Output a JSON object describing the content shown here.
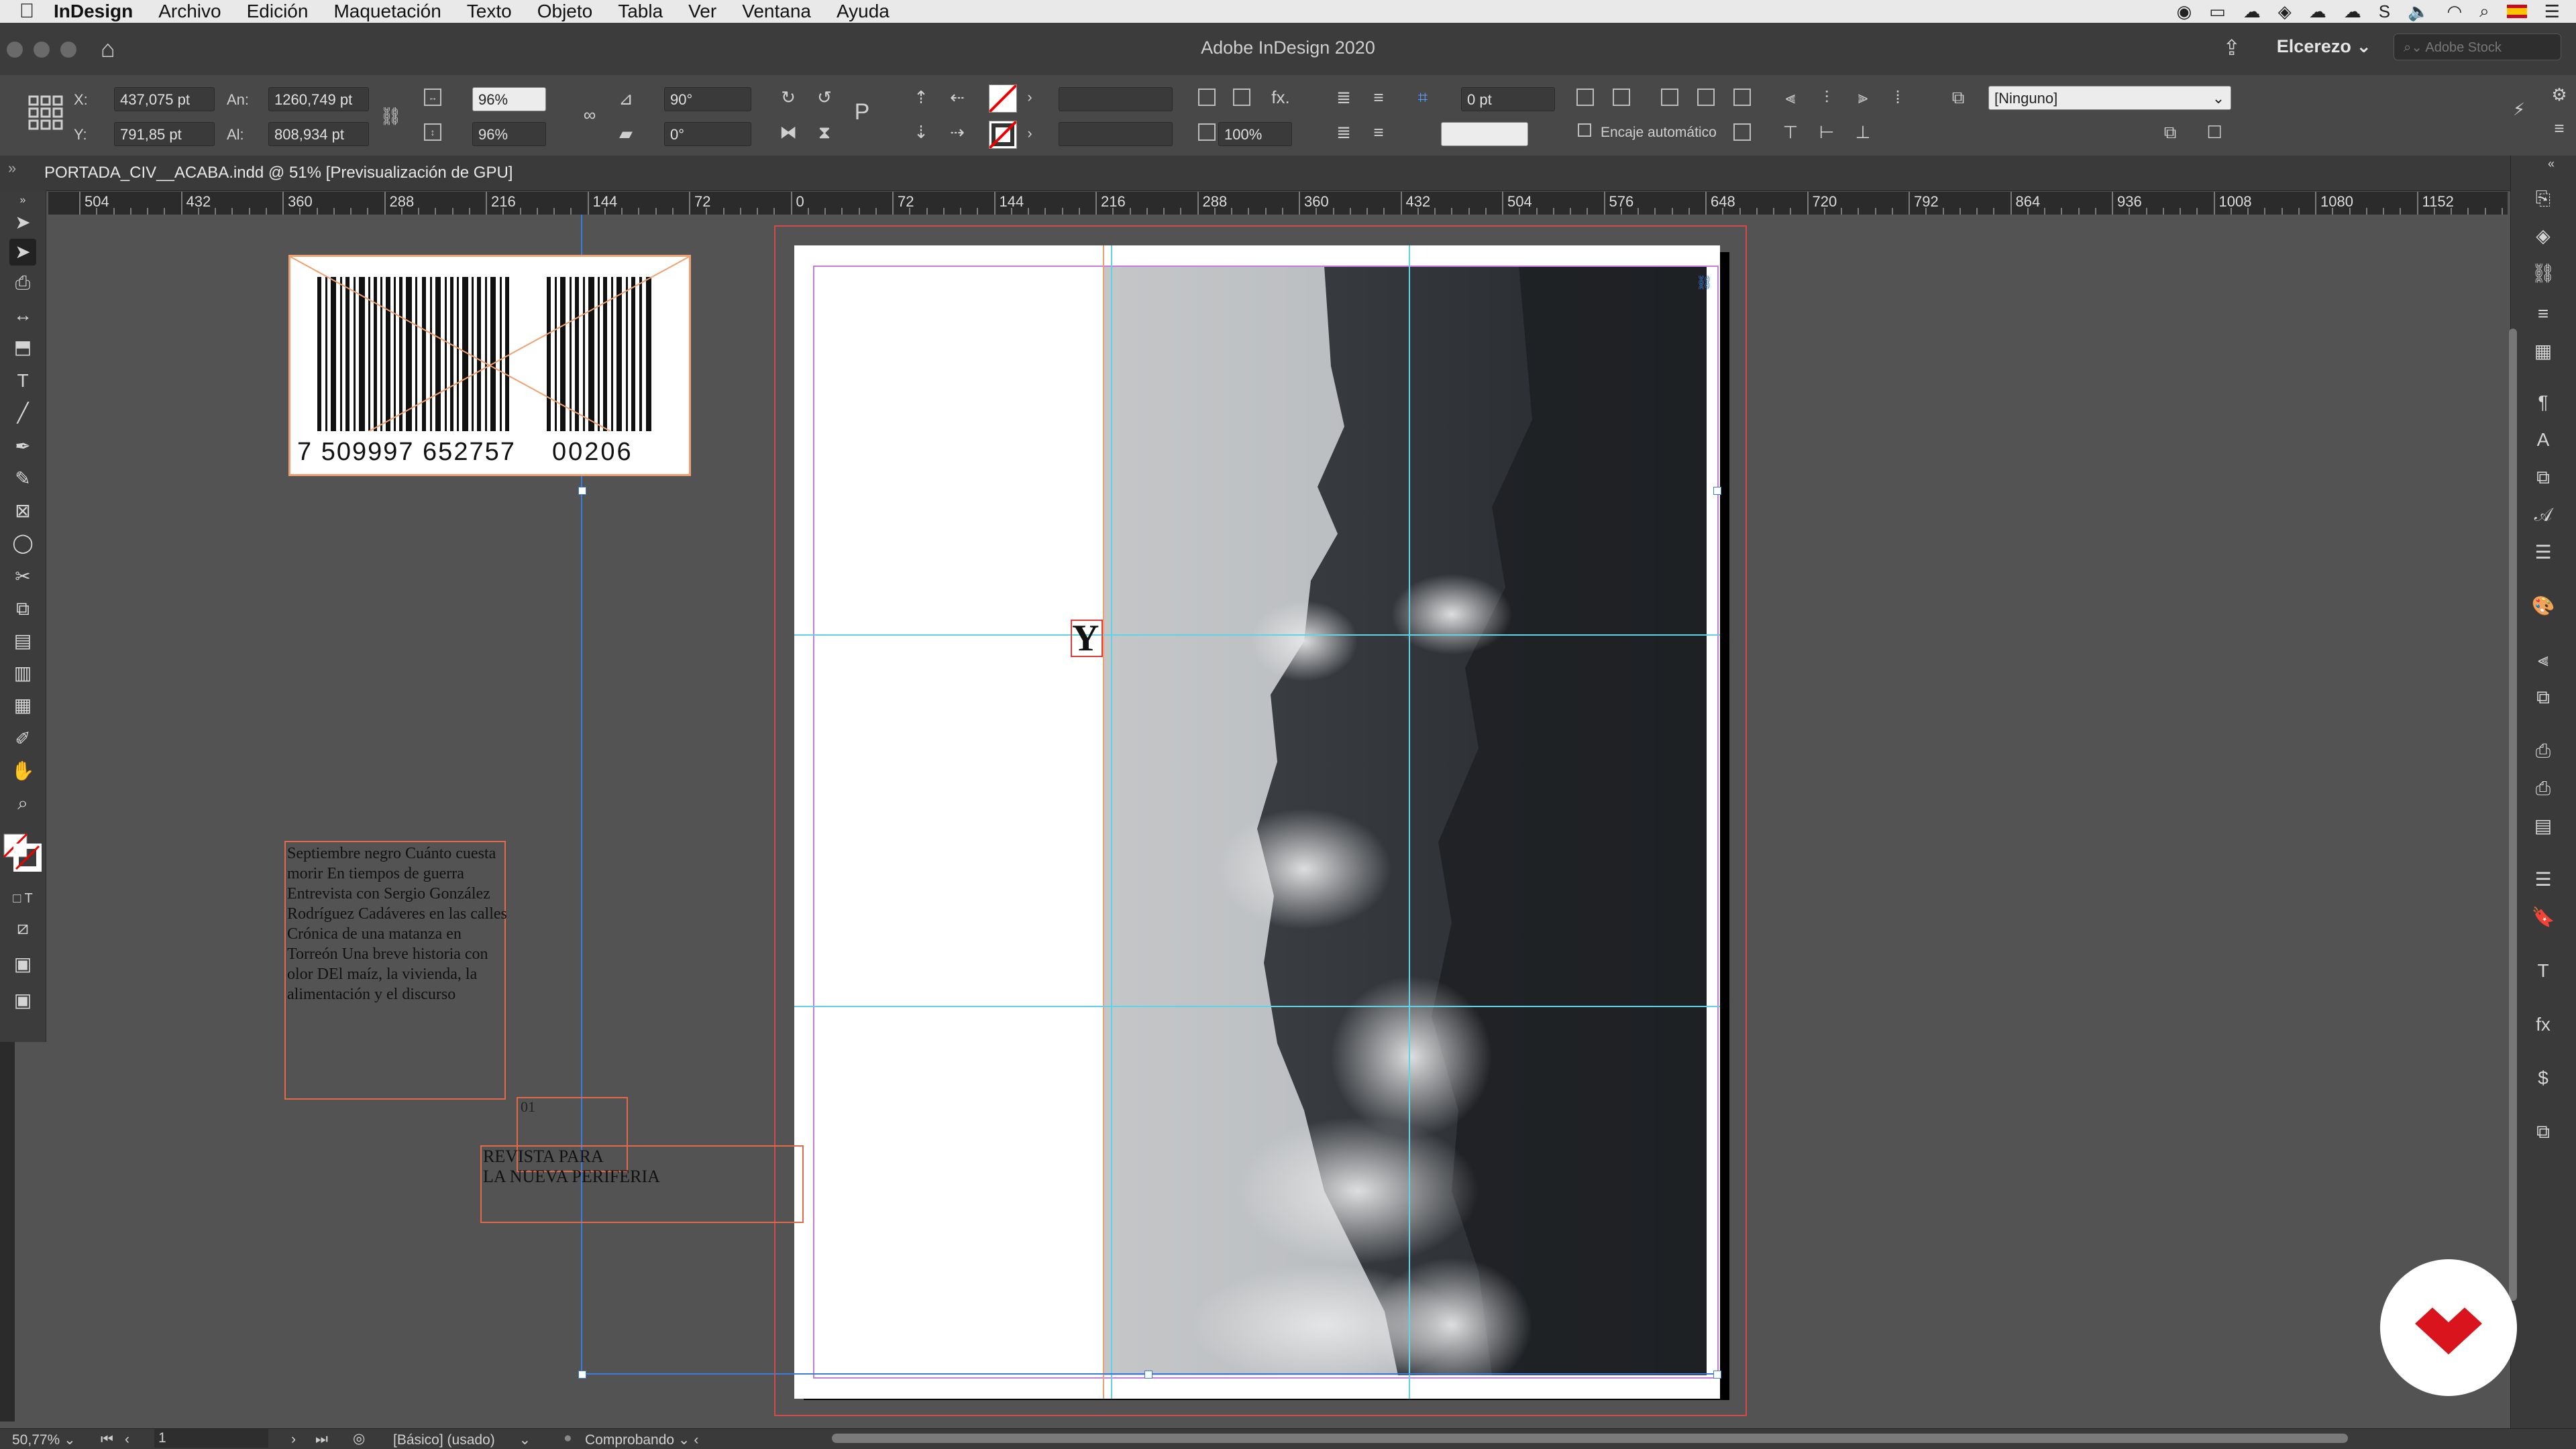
{
  "menubar": {
    "apple": "",
    "items": [
      "InDesign",
      "Archivo",
      "Edición",
      "Maquetación",
      "Texto",
      "Objeto",
      "Tabla",
      "Ver",
      "Ventana",
      "Ayuda"
    ]
  },
  "titlebar": {
    "title": "Adobe InDesign 2020",
    "workspace": "Elcerezo",
    "stock_placeholder": "Adobe Stock"
  },
  "control": {
    "x_label": "X:",
    "x_value": "437,075 pt",
    "y_label": "Y:",
    "y_value": "791,85 pt",
    "w_label": "An:",
    "w_value": "1260,749 pt",
    "h_label": "Al:",
    "h_value": "808,934 pt",
    "scale_x": "96%",
    "scale_y": "96%",
    "rotation": "90°",
    "shear": "0°",
    "stroke_weight": "0 pt",
    "opacity": "100%",
    "autofit_label": "Encaje automático",
    "object_style": "[Ninguno]"
  },
  "document": {
    "tab_title": "PORTADA_CIV__ACABA.indd @ 51% [Previsualización de GPU]"
  },
  "ruler": {
    "labels": [
      "504",
      "432",
      "360",
      "288",
      "216",
      "144",
      "72",
      "0",
      "72",
      "144",
      "216",
      "288",
      "360",
      "432",
      "504",
      "576",
      "648",
      "720",
      "792",
      "864",
      "936",
      "1008",
      "1080",
      "1152"
    ]
  },
  "canvas": {
    "barcode_main": "7 509997 652757",
    "barcode_addon": "00206",
    "story_text": "Septiembre negro Cuánto cuesta morir En tiempos de guerra Entrevista con Sergio González Rodríguez Cadáveres en las calles Crónica de una matanza en Torreón Una breve historia con olor DEl maíz, la vivienda, la alimentación y el discurso",
    "issue_number": "01",
    "magazine_tagline": "REVISTA PARA\nLA NUEVA PERIFERIA",
    "cover_letter": "Y"
  },
  "status": {
    "zoom": "50,77%",
    "page": "1",
    "style": "[Básico] (usado)",
    "preflight": "Comprobando"
  },
  "colors": {
    "frame_edge": "#e06a4a",
    "guide": "#5fd4e6",
    "margin": "#c77be0",
    "bleed": "#d24a4a",
    "brand_badge": "#d9141c"
  }
}
